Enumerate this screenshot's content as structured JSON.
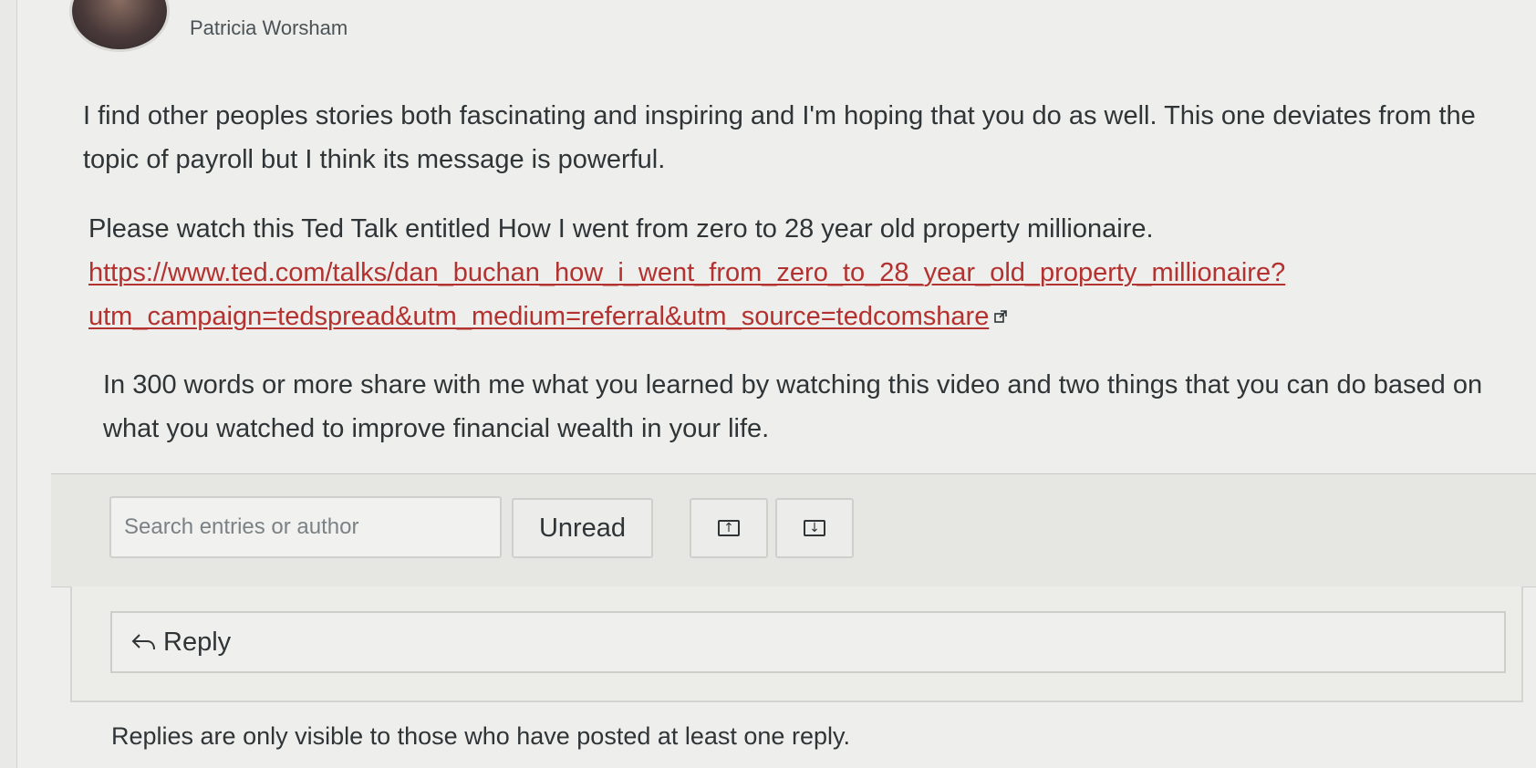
{
  "post": {
    "author": "Patricia Worsham",
    "paragraph1": "I find other peoples stories both fascinating and inspiring and I'm hoping that you do as well. This one deviates from the topic of payroll but I think its message is powerful.",
    "paragraph2_intro": "Please watch this Ted Talk entitled How I went from zero to 28 year old property millionaire.",
    "link_text": "https://www.ted.com/talks/dan_buchan_how_i_went_from_zero_to_28_year_old_property_millionaire?utm_campaign=tedspread&utm_medium=referral&utm_source=tedcomshare",
    "link_icon": "external-link-icon",
    "paragraph3": "In 300 words or more share with me what you learned by watching this video and two things that you can do based on what you watched to improve financial wealth in your life."
  },
  "toolbar": {
    "search_placeholder": "Search entries or author",
    "unread_label": "Unread",
    "expand_icon": "arrow-up-box-icon",
    "collapse_icon": "arrow-down-box-icon"
  },
  "reply": {
    "label": "Reply",
    "icon": "reply-arrow-icon"
  },
  "notice": "Replies are only visible to those who have posted at least one reply.",
  "colors": {
    "link": "#b3312f",
    "text": "#2f3437",
    "background": "#eeeeec"
  }
}
